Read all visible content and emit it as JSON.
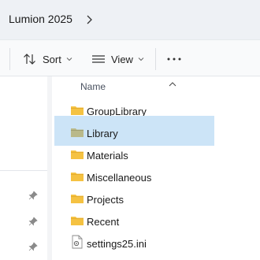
{
  "address": {
    "breadcrumb": "Lumion 2025"
  },
  "toolbar": {
    "sort_label": "Sort",
    "view_label": "View"
  },
  "list": {
    "column_name": "Name",
    "items": [
      {
        "label": "GroupLibrary",
        "type": "folder"
      },
      {
        "label": "Library",
        "type": "folder",
        "selected": true
      },
      {
        "label": "Materials",
        "type": "folder"
      },
      {
        "label": "Miscellaneous",
        "type": "folder"
      },
      {
        "label": "Projects",
        "type": "folder"
      },
      {
        "label": "Recent",
        "type": "folder"
      },
      {
        "label": "settings25.ini",
        "type": "ini-file"
      }
    ]
  },
  "colors": {
    "selection": "#cce4f7",
    "folder": "#f5c242",
    "selected_folder": "#b9b98a"
  }
}
